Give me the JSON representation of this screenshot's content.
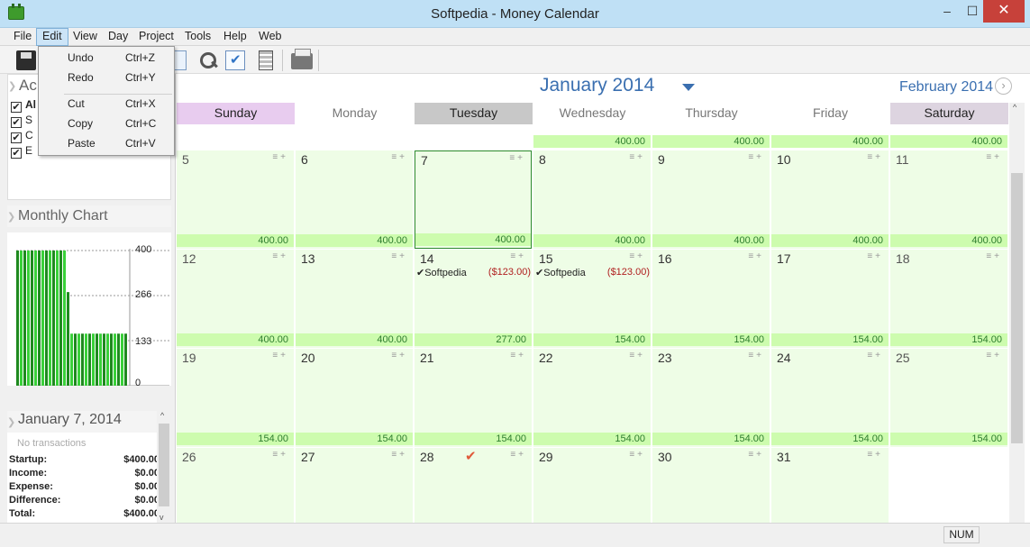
{
  "window": {
    "title": "Softpedia - Money Calendar"
  },
  "menu": [
    "File",
    "Edit",
    "View",
    "Day",
    "Project",
    "Tools",
    "Help",
    "Web"
  ],
  "edit_menu": [
    {
      "label": "Undo",
      "shortcut": "Ctrl+Z"
    },
    {
      "label": "Redo",
      "shortcut": "Ctrl+Y"
    },
    {
      "label": "Cut",
      "shortcut": "Ctrl+X"
    },
    {
      "label": "Copy",
      "shortcut": "Ctrl+C"
    },
    {
      "label": "Paste",
      "shortcut": "Ctrl+V"
    }
  ],
  "accounts": {
    "title": "Ac",
    "rows": [
      {
        "label": "Al",
        "checked": true,
        "bold": true
      },
      {
        "label": "S",
        "checked": true
      },
      {
        "label": "C",
        "checked": true
      },
      {
        "label": "E",
        "checked": true
      }
    ]
  },
  "monthly_chart": {
    "title": "Monthly Chart",
    "ticks": [
      "400",
      "266",
      "133",
      "0"
    ],
    "colors": {
      "bar_dark": "#1e8a1e",
      "bar_light": "#39d139"
    }
  },
  "selected_day": {
    "title": "January 7, 2014",
    "no_tx": "No transactions",
    "rows": [
      {
        "label": "Startup:",
        "value": "$400.00"
      },
      {
        "label": "Income:",
        "value": "$0.00"
      },
      {
        "label": "Expense:",
        "value": "$0.00"
      },
      {
        "label": "Difference:",
        "value": "$0.00"
      },
      {
        "label": "Total:",
        "value": "$400.00"
      }
    ]
  },
  "calendar": {
    "month": "January 2014",
    "next_month": "February 2014",
    "days": [
      "Sunday",
      "Monday",
      "Tuesday",
      "Wednesday",
      "Thursday",
      "Friday",
      "Saturday"
    ],
    "day_colors": [
      "#e8ccef",
      "#ffffff",
      "#c8c8c8",
      "#ffffff",
      "#ffffff",
      "#ffffff",
      "#ddd4e0"
    ],
    "weeks": [
      [
        {
          "blank": true
        },
        {
          "blank": true
        },
        {
          "blank": true
        },
        {
          "bal": "400.00",
          "short": true
        },
        {
          "bal": "400.00",
          "short": true
        },
        {
          "bal": "400.00",
          "short": true
        },
        {
          "bal": "400.00",
          "short": true
        }
      ],
      [
        {
          "day": "5",
          "bal": "400.00"
        },
        {
          "day": "6",
          "bal": "400.00"
        },
        {
          "day": "7",
          "bal": "400.00",
          "today": true
        },
        {
          "day": "8",
          "bal": "400.00"
        },
        {
          "day": "9",
          "bal": "400.00"
        },
        {
          "day": "10",
          "bal": "400.00"
        },
        {
          "day": "11",
          "bal": "400.00"
        }
      ],
      [
        {
          "day": "12",
          "bal": "400.00"
        },
        {
          "day": "13",
          "bal": "400.00"
        },
        {
          "day": "14",
          "bal": "277.00",
          "tx": {
            "name": "Softpedia",
            "amount": "($123.00)"
          }
        },
        {
          "day": "15",
          "bal": "154.00",
          "tx": {
            "name": "Softpedia",
            "amount": "($123.00)"
          }
        },
        {
          "day": "16",
          "bal": "154.00"
        },
        {
          "day": "17",
          "bal": "154.00"
        },
        {
          "day": "18",
          "bal": "154.00"
        }
      ],
      [
        {
          "day": "19",
          "bal": "154.00"
        },
        {
          "day": "20",
          "bal": "154.00"
        },
        {
          "day": "21",
          "bal": "154.00"
        },
        {
          "day": "22",
          "bal": "154.00"
        },
        {
          "day": "23",
          "bal": "154.00"
        },
        {
          "day": "24",
          "bal": "154.00"
        },
        {
          "day": "25",
          "bal": "154.00"
        }
      ],
      [
        {
          "day": "26"
        },
        {
          "day": "27"
        },
        {
          "day": "28",
          "check": true
        },
        {
          "day": "29"
        },
        {
          "day": "30"
        },
        {
          "day": "31"
        },
        {
          "blank": true,
          "white": true
        }
      ]
    ]
  },
  "status": {
    "num": "NUM"
  }
}
